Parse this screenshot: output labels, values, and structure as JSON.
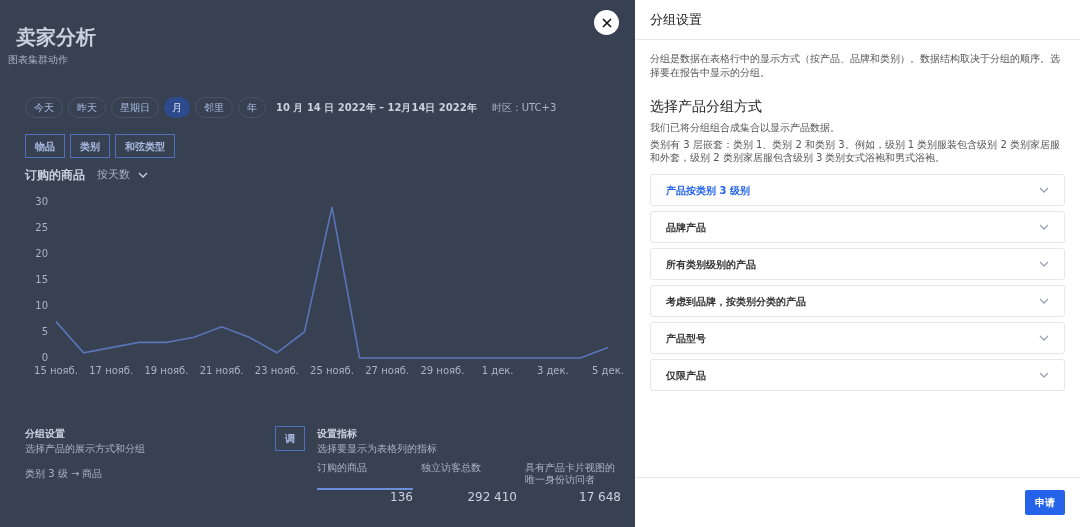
{
  "page": {
    "title": "卖家分析",
    "subtitle": "图表集群动作",
    "periods": [
      {
        "label": "今天",
        "selected": false
      },
      {
        "label": "昨天",
        "selected": false
      },
      {
        "label": "星期日",
        "selected": false
      },
      {
        "label": "月",
        "selected": true
      },
      {
        "label": "邻里",
        "selected": false
      },
      {
        "label": "年",
        "selected": false
      }
    ],
    "date_range": "10 月 14 日 2022年 – 12月14日 2022年",
    "timezone": "时区：UTC+3",
    "view_tabs": [
      "物品",
      "类别",
      "和弦类型"
    ],
    "chart": {
      "title": "订购的商品",
      "mode": "按天数",
      "chart_data": {
        "type": "line",
        "categories": [
          "15 нояб.",
          null,
          "17 нояб.",
          null,
          "19 нояб.",
          null,
          "21 нояб.",
          null,
          "23 нояб.",
          null,
          "25 нояб.",
          null,
          "27 нояб.",
          null,
          "29 нояб.",
          null,
          "1 дек.",
          null,
          "3 дек.",
          null,
          "5 дек."
        ],
        "series": [
          {
            "color": "#5a74b8",
            "values": [
              7,
              1,
              2,
              3,
              3,
              4,
              6,
              4,
              1,
              5,
              29,
              0,
              0,
              0,
              0,
              0,
              0,
              0,
              0,
              0,
              2
            ]
          }
        ],
        "ylim": [
          0,
          30
        ],
        "yticks": [
          0,
          5,
          10,
          15,
          20,
          25,
          30
        ]
      }
    },
    "grouping": {
      "title": "分组设置",
      "hint": "选择产品的展示方式和分组",
      "button": "调",
      "path": "类别 3 级 → 商品"
    },
    "metrics": {
      "title": "设置指标",
      "hint": "选择要显示为表格列的指标",
      "columns": [
        {
          "label": "订购的商品",
          "selected": true
        },
        {
          "label": "独立访客总数",
          "selected": false
        },
        {
          "label": "具有产品卡片视图的唯一身份访问者",
          "selected": false
        }
      ],
      "values": [
        "136",
        "292 410",
        "17 648"
      ]
    }
  },
  "drawer": {
    "title": "分组设置",
    "description": "分组是数据在表格行中的显示方式（按产品、品牌和类别）。数据结构取决于分组的顺序。选择要在报告中显示的分组。",
    "section_title": "选择产品分组方式",
    "note": "我们已将分组组合成集合以显示产品数据。",
    "detail": "类别有 3 层嵌套：类别 1、类别 2 和类别 3。例如，级别 1 类别服装包含级别 2 类别家居服和外套，级别 2 类别家居服包含级别 3 类别女式浴袍和男式浴袍。",
    "options": [
      {
        "label": "产品按类别 3 级别",
        "selected": true
      },
      {
        "label": "品牌产品",
        "selected": false
      },
      {
        "label": "所有类别级别的产品",
        "selected": false
      },
      {
        "label": "考虑到品牌，按类别分类的产品",
        "selected": false
      },
      {
        "label": "产品型号",
        "selected": false
      },
      {
        "label": "仅限产品",
        "selected": false
      }
    ],
    "apply": "申请"
  }
}
